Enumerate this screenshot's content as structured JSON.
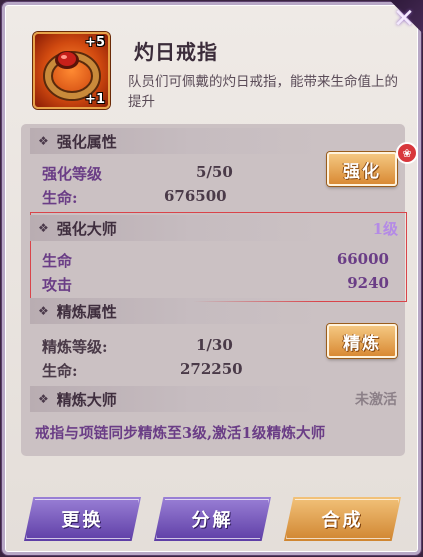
{
  "item": {
    "name": "灼日戒指",
    "badge_top": "+5",
    "badge_bottom": "+1",
    "description": "队员们可佩戴的灼日戒指，能带来生命值上的提升"
  },
  "enhance": {
    "section_title": "强化属性",
    "level_label": "强化等级",
    "level_value": "5/50",
    "hp_label": "生命:",
    "hp_value": "676500",
    "button_label": "强化",
    "badge": "❀"
  },
  "enhance_master": {
    "section_title": "强化大师",
    "level": "1级",
    "hp_label": "生命",
    "hp_value": "66000",
    "atk_label": "攻击",
    "atk_value": "9240"
  },
  "refine": {
    "section_title": "精炼属性",
    "level_label": "精炼等级:",
    "level_value": "1/30",
    "hp_label": "生命:",
    "hp_value": "272250",
    "button_label": "精炼"
  },
  "refine_master": {
    "section_title": "精炼大师",
    "status": "未激活",
    "description": "戒指与项链同步精炼至3级,激活1级精炼大师"
  },
  "actions": {
    "replace": "更换",
    "decompose": "分解",
    "compose": "合成"
  },
  "icons": {
    "close": "close-icon",
    "section": "diamond-icon"
  },
  "colors": {
    "accent_purple": "#6a3d86",
    "master_level": "#b48ae6",
    "highlight_border": "#d9444a"
  }
}
